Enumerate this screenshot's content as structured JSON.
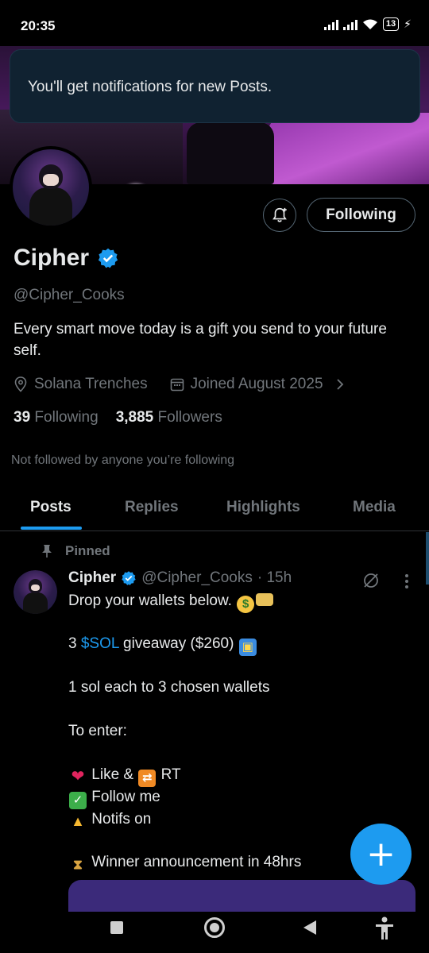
{
  "status_bar": {
    "time": "20:35",
    "battery": "13"
  },
  "toast": {
    "message": "You'll get notifications for new Posts."
  },
  "profile": {
    "name": "Cipher",
    "handle": "@Cipher_Cooks",
    "bio": "Every smart move today is a gift you send to your future self.",
    "location": "Solana Trenches",
    "joined": "Joined August 2025",
    "following_count": "39",
    "following_label": "Following",
    "followers_count": "3,885",
    "followers_label": "Followers",
    "not_followed_text": "Not followed by anyone you’re following",
    "follow_button_label": "Following"
  },
  "tabs": [
    {
      "label": "Posts",
      "active": true
    },
    {
      "label": "Replies",
      "active": false
    },
    {
      "label": "Highlights",
      "active": false
    },
    {
      "label": "Media",
      "active": false
    }
  ],
  "post": {
    "pinned_label": "Pinned",
    "author_name": "Cipher",
    "author_handle": "@Cipher_Cooks",
    "time": "· 15h",
    "line1": "Drop your wallets below.",
    "line2_pre": "3",
    "line2_cashtag": "$SOL",
    "line2_post": "giveaway ($260)",
    "line3": "1 sol each to 3 chosen wallets",
    "line4": "To enter:",
    "line5_a": "Like &",
    "line5_b": "RT",
    "line6": "Follow me",
    "line7": "Notifs on",
    "line8": "Winner announcement in 48hrs"
  },
  "fab": {
    "label": "+"
  },
  "colors": {
    "accent": "#1d9bf0",
    "muted": "#71767b",
    "text": "#e7e9ea",
    "background": "#000000"
  },
  "icons": [
    "bell-plus-icon",
    "verified-badge-icon",
    "location-pin-icon",
    "calendar-icon",
    "chevron-right-icon",
    "pin-icon",
    "grok-icon",
    "more-vertical-icon",
    "compose-plus-icon"
  ]
}
